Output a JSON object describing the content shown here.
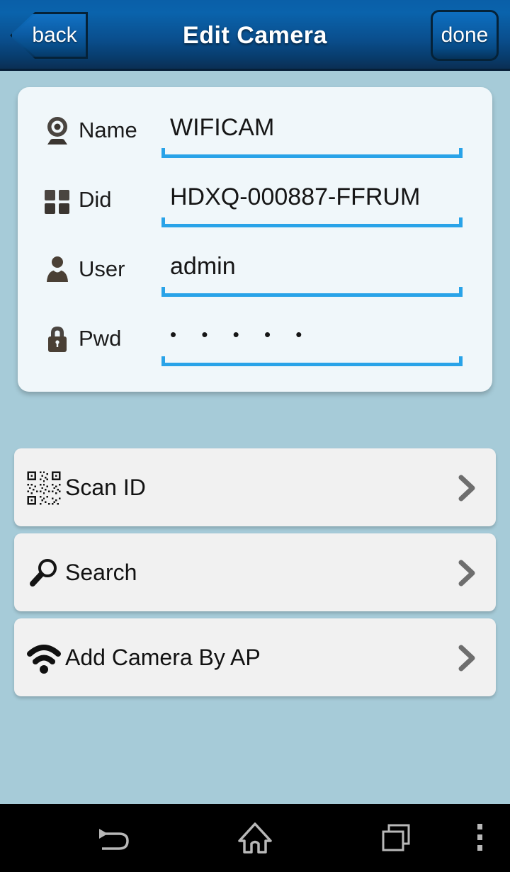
{
  "header": {
    "back_label": "back",
    "title": "Edit Camera",
    "done_label": "done",
    "gradient_top": "#0a63ac",
    "gradient_bottom": "#0b2c4f"
  },
  "theme": {
    "page_background": "#a6cbd8",
    "card_background": "#f0f7fa",
    "underline_accent": "#29a3e8",
    "row_background": "#f1f1f1",
    "chevron_color": "#6e6e6e",
    "navbar_background": "#000000"
  },
  "form": {
    "fields": [
      {
        "icon": "webcam-icon",
        "label": "Name",
        "value": "WIFICAM",
        "type": "text"
      },
      {
        "icon": "grid-icon",
        "label": "Did",
        "value": "HDXQ-000887-FFRUM",
        "type": "text"
      },
      {
        "icon": "person-icon",
        "label": "User",
        "value": "admin",
        "type": "text"
      },
      {
        "icon": "lock-icon",
        "label": "Pwd",
        "value": "• • • • •",
        "type": "password"
      }
    ]
  },
  "actions": [
    {
      "icon": "qr-code-icon",
      "label": "Scan ID",
      "chevron": "chevron-right-icon"
    },
    {
      "icon": "magnifier-icon",
      "label": "Search",
      "chevron": "chevron-right-icon"
    },
    {
      "icon": "wifi-icon",
      "label": "Add Camera By AP",
      "chevron": "chevron-right-icon"
    }
  ],
  "android_nav": {
    "back": "back-arrow-icon",
    "home": "home-icon",
    "recents": "recents-icon",
    "menu": "overflow-menu-icon"
  }
}
